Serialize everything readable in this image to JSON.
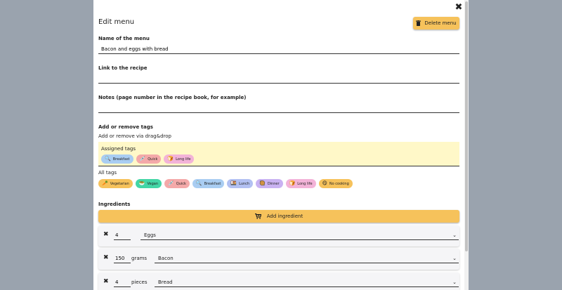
{
  "modal": {
    "title": "Edit menu",
    "delete_label": "Delete menu"
  },
  "fields": {
    "name_label": "Name of the menu",
    "name_value": "Bacon and eggs with bread",
    "link_label": "Link to the recipe",
    "link_value": "",
    "notes_label": "Notes (page number in the recipe book, for example)",
    "notes_value": ""
  },
  "tags_section": {
    "label": "Add or remove tags",
    "hint": "Add or remove via drag&drop",
    "assigned_label": "Assigned tags",
    "assigned": [
      {
        "label": "Breakfast",
        "icon": "magnifier-icon",
        "glyph": "🔍",
        "color": "#a9cdf2"
      },
      {
        "label": "Quick",
        "icon": "syringe-icon",
        "glyph": "💉",
        "color": "#f4a9a9"
      },
      {
        "label": "Long life",
        "icon": "bread-icon",
        "glyph": "🍞",
        "color": "#f3b3d8"
      }
    ],
    "all_label": "All tags",
    "all": [
      {
        "label": "Vegetarian",
        "icon": "carrot-icon",
        "glyph": "🥕",
        "color": "#f6c25b"
      },
      {
        "label": "Vegan",
        "icon": "bowl-icon",
        "glyph": "🥗",
        "color": "#43d6a6"
      },
      {
        "label": "Quick",
        "icon": "syringe-icon",
        "glyph": "💉",
        "color": "#f4a9a9"
      },
      {
        "label": "Breakfast",
        "icon": "magnifier-icon",
        "glyph": "🔍",
        "color": "#a9cdf2"
      },
      {
        "label": "Lunch",
        "icon": "bento-icon",
        "glyph": "🍱",
        "color": "#b2c0f2"
      },
      {
        "label": "Dinner",
        "icon": "plate-icon",
        "glyph": "🥘",
        "color": "#c9b2f2"
      },
      {
        "label": "Long life",
        "icon": "bread-icon",
        "glyph": "🍞",
        "color": "#f3b3d8"
      },
      {
        "label": "No cooking",
        "icon": "smile-icon",
        "glyph": "😋",
        "color": "#f6c25b"
      }
    ]
  },
  "ingredients": {
    "label": "Ingredients",
    "add_label": "Add ingredient",
    "items": [
      {
        "qty": "4",
        "unit": "",
        "name": "Eggs"
      },
      {
        "qty": "150",
        "unit": "grams",
        "name": "Bacon"
      },
      {
        "qty": "4",
        "unit": "pieces",
        "name": "Bread"
      }
    ]
  }
}
